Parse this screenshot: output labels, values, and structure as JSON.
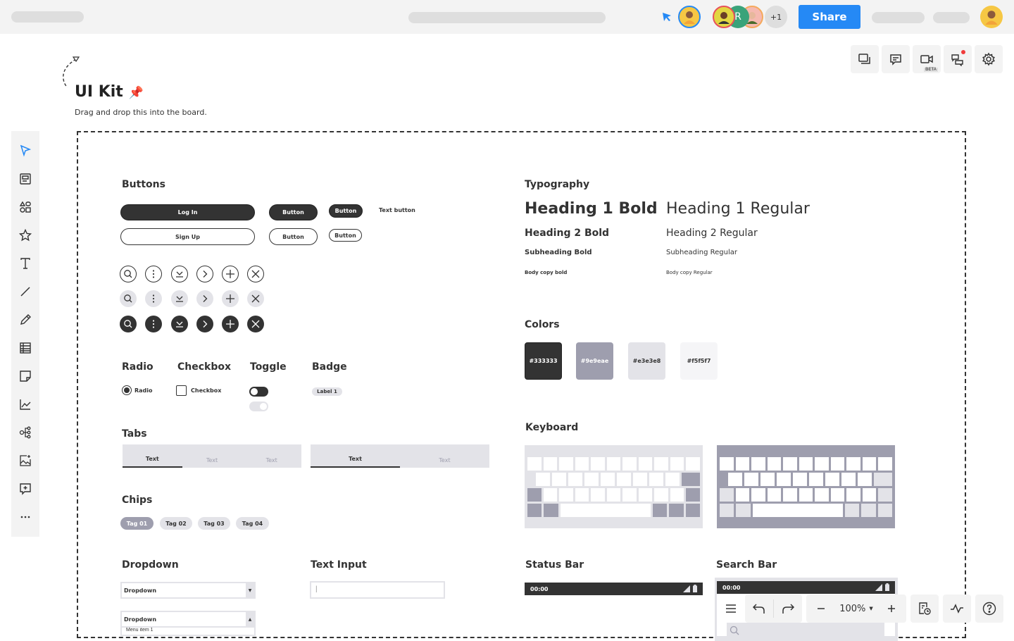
{
  "topbar": {
    "share_label": "Share",
    "collaborators": [
      {
        "initial": "",
        "ring": "#2589f5",
        "bg": "#f6c744"
      },
      {
        "initial": "",
        "ring": "#e8505b",
        "bg": "#e2d642"
      },
      {
        "initial": "R",
        "ring": "#3aa37a",
        "bg": "#3aa37a"
      },
      {
        "initial": "",
        "ring": "#f5a95c",
        "bg": "#f5b9b0"
      }
    ],
    "extra_count": "+1"
  },
  "right_tools": [
    {
      "name": "pages-icon"
    },
    {
      "name": "comment-icon"
    },
    {
      "name": "video-icon",
      "badge": "BETA"
    },
    {
      "name": "chat-icon",
      "notification": true
    },
    {
      "name": "settings-icon"
    }
  ],
  "left_tools": [
    "select-icon",
    "template-icon",
    "shapes-icon",
    "star-icon",
    "text-icon",
    "line-icon",
    "pen-icon",
    "table-icon",
    "sticky-note-icon",
    "chart-icon",
    "mindmap-icon",
    "image-icon",
    "add-comment-icon",
    "more-icon"
  ],
  "header": {
    "title": "UI Kit",
    "pin": "📌",
    "subtitle": "Drag and drop this into the board."
  },
  "buttons": {
    "heading": "Buttons",
    "login": "Log In",
    "signup": "Sign Up",
    "button": "Button",
    "text_button": "Text button"
  },
  "icon_buttons": [
    "search",
    "more-vertical",
    "download",
    "chevron-right",
    "plus",
    "close"
  ],
  "radio": {
    "heading": "Radio",
    "label": "Radio"
  },
  "checkbox": {
    "heading": "Checkbox",
    "label": "Checkbox"
  },
  "toggle": {
    "heading": "Toggle"
  },
  "badge": {
    "heading": "Badge",
    "label": "Label 1"
  },
  "tabs": {
    "heading": "Tabs",
    "group1": [
      "Text",
      "Text",
      "Text"
    ],
    "group2": [
      "Text",
      "Text"
    ]
  },
  "chips": {
    "heading": "Chips",
    "items": [
      "Tag 01",
      "Tag 02",
      "Tag 03",
      "Tag 04"
    ]
  },
  "dropdown": {
    "heading": "Dropdown",
    "label": "Dropdown",
    "label_open": "Dropdown",
    "first_item": "Menu item 1"
  },
  "text_input": {
    "heading": "Text Input",
    "value": "|"
  },
  "typography": {
    "heading": "Typography",
    "h1_bold": "Heading 1 Bold",
    "h1_regular": "Heading 1 Regular",
    "h2_bold": "Heading 2 Bold",
    "h2_regular": "Heading 2 Regular",
    "sub_bold": "Subheading Bold",
    "sub_regular": "Subheading Regular",
    "body_bold": "Body copy bold",
    "body_regular": "Body copy Regular"
  },
  "colors": {
    "heading": "Colors",
    "swatches": [
      {
        "hex": "#333333",
        "label": "#333333",
        "text": "#ffffff"
      },
      {
        "hex": "#9e9eae",
        "label": "#9e9eae",
        "text": "#ffffff"
      },
      {
        "hex": "#e3e3e8",
        "label": "#e3e3e8",
        "text": "#333333"
      },
      {
        "hex": "#f5f5f7",
        "label": "#f5f5f7",
        "text": "#333333"
      }
    ]
  },
  "keyboard": {
    "heading": "Keyboard"
  },
  "status_bar": {
    "heading": "Status Bar",
    "time": "00:00"
  },
  "search_bar": {
    "heading": "Search Bar",
    "time": "00:00"
  },
  "bottom_toolbar": {
    "zoom": "100%"
  }
}
